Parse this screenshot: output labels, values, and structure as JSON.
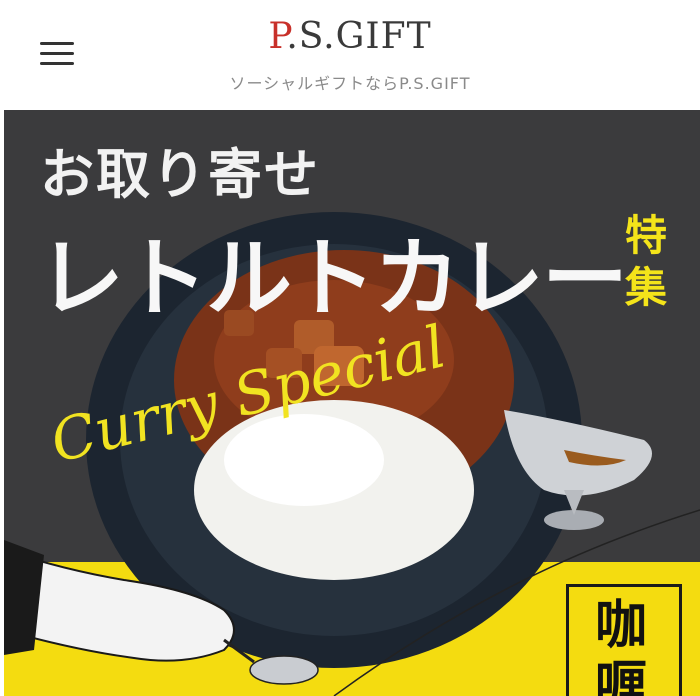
{
  "header": {
    "logo_p": "P",
    "logo_rest": ".S.GIFT",
    "tagline": "ソーシャルギフトならP.S.GIFT"
  },
  "banner": {
    "title_small": "お取り寄せ",
    "title_large": "レトルトカレー",
    "feature": "特集",
    "script": "Curry Special",
    "kanji": "咖喱"
  },
  "colors": {
    "logo_accent": "#c8302a",
    "banner_background": "#3b3b3d",
    "accent_yellow": "#f4e41a"
  },
  "icons": {
    "menu": "hamburger-menu-icon"
  }
}
